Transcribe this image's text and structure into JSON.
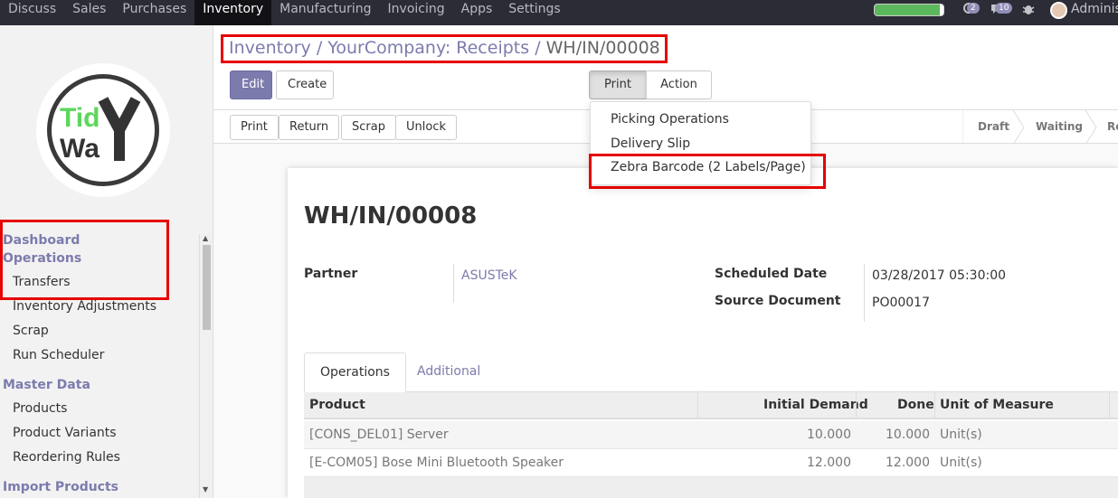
{
  "topbar": {
    "menu": [
      "Discuss",
      "Sales",
      "Purchases",
      "Inventory",
      "Manufacturing",
      "Invoicing",
      "Apps",
      "Settings"
    ],
    "active_menu": "Inventory",
    "activity_count": "2",
    "messages_count": "10",
    "user_name": "Adminis",
    "progress_fraction": 0.95
  },
  "sidebar": {
    "logo_text": [
      "Tid",
      "WaY"
    ],
    "sections": [
      {
        "label": "Dashboard",
        "items": []
      },
      {
        "label": "Operations",
        "items": [
          "Transfers",
          "Inventory Adjustments",
          "Scrap",
          "Run Scheduler"
        ]
      },
      {
        "label": "Master Data",
        "items": [
          "Products",
          "Product Variants",
          "Reordering Rules"
        ]
      },
      {
        "label": "Import Products",
        "items": []
      }
    ]
  },
  "breadcrumb": {
    "items": [
      "Inventory",
      "YourCompany: Receipts"
    ],
    "separator": "/",
    "current": "WH/IN/00008"
  },
  "buttons": {
    "edit": "Edit",
    "create": "Create",
    "print": "Print",
    "action": "Action"
  },
  "print_menu": [
    "Picking Operations",
    "Delivery Slip",
    "Zebra Barcode (2 Labels/Page)"
  ],
  "statusbar": {
    "buttons": [
      "Print",
      "Return",
      "Scrap",
      "Unlock"
    ],
    "stages": [
      "Draft",
      "Waiting",
      "Re"
    ]
  },
  "form": {
    "title": "WH/IN/00008",
    "partner_label": "Partner",
    "partner_value": "ASUSTeK",
    "scheduled_label": "Scheduled Date",
    "scheduled_value": "03/28/2017 05:30:00",
    "source_label": "Source Document",
    "source_value": "PO00017"
  },
  "tabs": [
    "Operations",
    "Additional Info"
  ],
  "table": {
    "columns": [
      "Product",
      "Initial Demand",
      "Done",
      "Unit of Measure"
    ],
    "rows": [
      [
        "[CONS_DEL01] Server",
        "10.000",
        "10.000",
        "Unit(s)"
      ],
      [
        "[E-COM05] Bose Mini Bluetooth Speaker",
        "12.000",
        "12.000",
        "Unit(s)"
      ]
    ]
  },
  "colors": {
    "brand": "#7c7bad",
    "navbar": "#2c2c36",
    "highlight": "#e60000"
  }
}
